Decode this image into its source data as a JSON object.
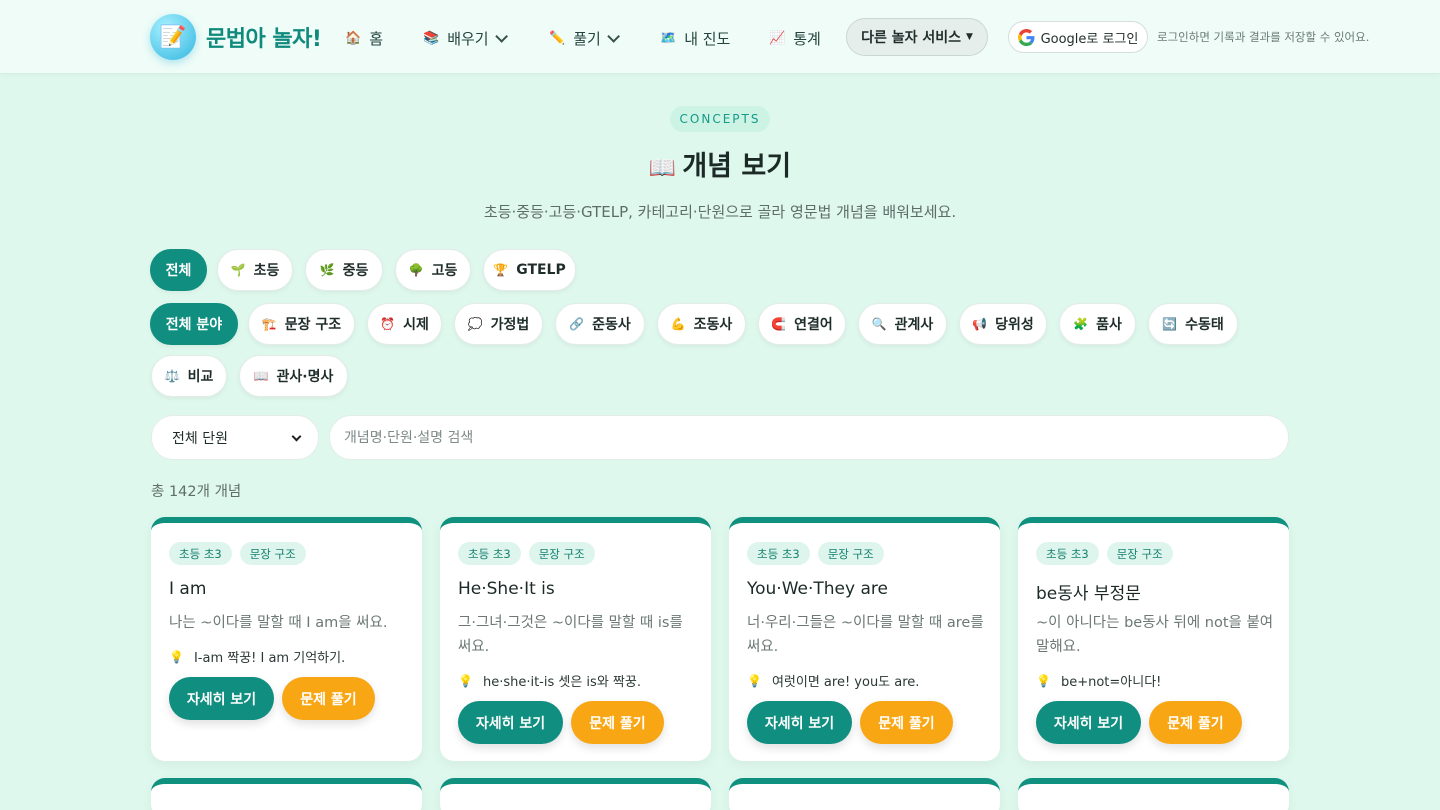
{
  "brand": {
    "title": "문법아 놀자!",
    "logo_icon": "memo-icon"
  },
  "nav": {
    "items": [
      {
        "label": "홈",
        "icon": "🏠"
      },
      {
        "label": "배우기",
        "icon": "📚"
      },
      {
        "label": "풀기",
        "icon": "✏️"
      },
      {
        "label": "내 진도",
        "icon": "🗺️"
      },
      {
        "label": "통계",
        "icon": "📈"
      }
    ],
    "other_services": "다른 놀자 서비스",
    "google_login": "Google로 로그인",
    "login_hint": "로그인하면 기록과 결과를 저장할 수 있어요."
  },
  "hero": {
    "eyebrow": "CONCEPTS",
    "title_icon": "📖",
    "title": "개념 보기",
    "subtitle": "초등·중등·고등·GTELP, 카테고리·단원으로 골라 영문법 개념을 배워보세요."
  },
  "level_chips": [
    {
      "label": "전체",
      "icon": ""
    },
    {
      "label": "초등",
      "icon": "🌱"
    },
    {
      "label": "중등",
      "icon": "🌿"
    },
    {
      "label": "고등",
      "icon": "🌳"
    },
    {
      "label": "GTELP",
      "icon": "🏆"
    }
  ],
  "category_chips": [
    {
      "label": "전체 분야",
      "icon": ""
    },
    {
      "label": "문장 구조",
      "icon": "🏗️"
    },
    {
      "label": "시제",
      "icon": "⏰"
    },
    {
      "label": "가정법",
      "icon": "💭"
    },
    {
      "label": "준동사",
      "icon": "🔗"
    },
    {
      "label": "조동사",
      "icon": "💪"
    },
    {
      "label": "연결어",
      "icon": "🧲"
    },
    {
      "label": "관계사",
      "icon": "🔍"
    },
    {
      "label": "당위성",
      "icon": "📢"
    },
    {
      "label": "품사",
      "icon": "🧩"
    },
    {
      "label": "수동태",
      "icon": "🔄"
    },
    {
      "label": "비교",
      "icon": "⚖️"
    },
    {
      "label": "관사·명사",
      "icon": "📖"
    }
  ],
  "filters": {
    "unit_select": "전체 단원",
    "search_placeholder": "개념명·단원·설명 검색",
    "count_text": "총 142개 개념"
  },
  "cards": [
    {
      "level_tag": "초등 초3",
      "category_tag": "문장 구조",
      "title": "I am",
      "desc": "나는 ~이다를 말할 때 I am을 써요.",
      "tip": "I-am 짝꿍! I am 기억하기.",
      "detail_label": "자세히 보기",
      "quiz_label": "문제 풀기"
    },
    {
      "level_tag": "초등 초3",
      "category_tag": "문장 구조",
      "title": "He·She·It is",
      "desc": "그·그녀·그것은 ~이다를 말할 때 is를 써요.",
      "tip": "he·she·it-is 셋은 is와 짝꿍.",
      "detail_label": "자세히 보기",
      "quiz_label": "문제 풀기"
    },
    {
      "level_tag": "초등 초3",
      "category_tag": "문장 구조",
      "title": "You·We·They are",
      "desc": "너·우리·그들은 ~이다를 말할 때 are를 써요.",
      "tip": "여럿이면 are! you도 are.",
      "detail_label": "자세히 보기",
      "quiz_label": "문제 풀기"
    },
    {
      "level_tag": "초등 초3",
      "category_tag": "문장 구조",
      "title": "be동사 부정문",
      "desc": "~이 아니다는 be동사 뒤에 not을 붙여 말해요.",
      "tip": "be+not=아니다!",
      "detail_label": "자세히 보기",
      "quiz_label": "문제 풀기"
    }
  ],
  "colors": {
    "accent": "#108e80",
    "quiz_button": "#f8a614",
    "background": "#dff8ee"
  }
}
